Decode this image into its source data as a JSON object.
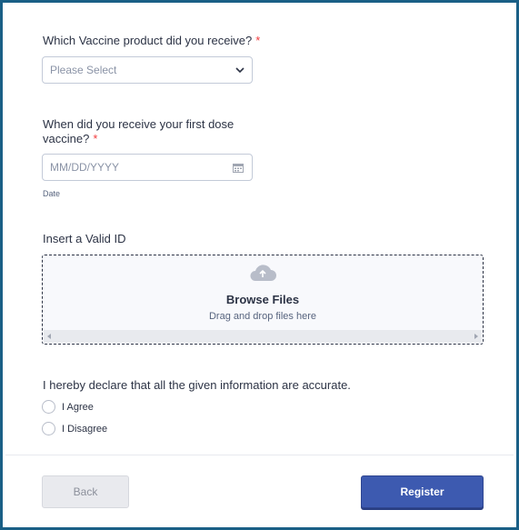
{
  "vaccine": {
    "label": "Which Vaccine product did you receive?",
    "required_mark": "*",
    "placeholder": "Please Select",
    "icon": "chevron-down-icon"
  },
  "first_dose": {
    "label_line1": "When did you receive your first dose",
    "label_line2": "vaccine?",
    "required_mark": "*",
    "placeholder": "MM/DD/YYYY",
    "sublabel": "Date",
    "icon": "calendar-icon"
  },
  "valid_id": {
    "label": "Insert a Valid ID",
    "browse_title": "Browse Files",
    "browse_hint": "Drag and drop files here",
    "icon": "cloud-upload-icon"
  },
  "declaration": {
    "label": "I hereby declare that all the given information are accurate.",
    "options": [
      "I Agree",
      "I Disagree"
    ]
  },
  "buttons": {
    "back": "Back",
    "register": "Register"
  },
  "colors": {
    "frame_border": "#1a5f86",
    "required": "#f23a3c",
    "primary": "#3d5ab0"
  }
}
